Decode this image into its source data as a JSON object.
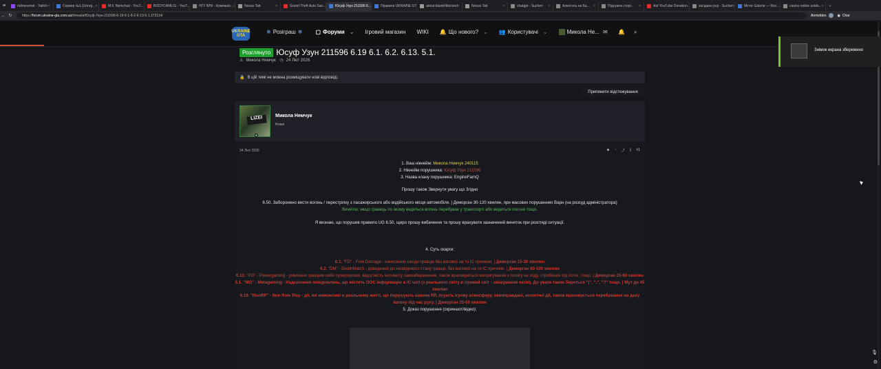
{
  "browser": {
    "menu_icon": "menu-icon",
    "tabs": [
      {
        "label": "mdmevmvk - Twitch",
        "color": "#9146ff"
      },
      {
        "label": "Сервер №1 [Unreg...",
        "color": "#3d7bd9"
      },
      {
        "label": "M.F. Nemchuk - YouT...",
        "color": "#e52d27"
      },
      {
        "label": "BODYCAMLIG - YouT...",
        "color": "#e52d27"
      },
      {
        "label": "НГУ ВЛК - Компаніо...",
        "color": "#888"
      },
      {
        "label": "Nexus Tab",
        "color": "#999"
      },
      {
        "label": "Grand Theft Auto San...",
        "color": "#e52d27"
      },
      {
        "label": "Юсуф Узун 211596 6...",
        "color": "#3d7bd9"
      },
      {
        "label": "Правила UKRAINE GT...",
        "color": "#3d7bd9"
      },
      {
        "label": "about:blank#blocked",
        "color": "#999"
      },
      {
        "label": "Nexus Tab",
        "color": "#999"
      },
      {
        "label": "chatgpt - Suchen",
        "color": "#888"
      },
      {
        "label": "Алкоголь на Ба...",
        "color": "#888"
      },
      {
        "label": "Підсумок сторі...",
        "color": "#888"
      },
      {
        "label": "Auf YouTube Donation...",
        "color": "#e52d27"
      },
      {
        "label": "засіданн рєр - Suchen",
        "color": "#888"
      },
      {
        "label": "Mirror Galerie — Rec...",
        "color": "#3d7bd9"
      },
      {
        "label": "casino online soldo...",
        "color": "#888"
      }
    ],
    "new_tab": "+",
    "url_prefix": "https://",
    "url_host": "forum.ukraine-gta.com.ua",
    "url_path": "/threads/Юсуф-Узун-211596-6-19-6-1-6-2-6-13-5-1.373114/",
    "profile_name": "Anmelden",
    "chat": "Chat"
  },
  "site": {
    "logo": "UKRAINE GTA",
    "nav": [
      {
        "label": "Розіграш",
        "icon": "snowflake-icon"
      },
      {
        "label": "Форуми",
        "icon": "chat-icon"
      },
      {
        "label": "Ігровий магазин"
      },
      {
        "label": "WIKI"
      },
      {
        "label": "Що нового?",
        "icon": "alert-icon"
      },
      {
        "label": "Користувачі",
        "icon": "users-icon"
      },
      {
        "label": "Микола Не...",
        "icon": "avatar-icon"
      }
    ],
    "status": "Розглянуто",
    "title": "Юсуф Узун 211596 6.19 6.1. 6.2. 6.13. 5.1.",
    "meta_author": "Микола Немчук",
    "meta_date": "24 Лют 2026",
    "notice": "В цій темі не можна розміщувати нові відповіді.",
    "follow": "Припинити відстежування"
  },
  "post": {
    "author": "Микола Немчук",
    "role": "Козак",
    "avatar_text": "LIZEI",
    "date": "24 Лют 2026",
    "number": "#1",
    "line1_prefix": "1. Ваш нікнейм:",
    "line1_value": "Микола Немчук 240115",
    "line2_prefix": "2. Нікнейм порушника:",
    "line2_value": "Юсуф Узун 211596",
    "line3": "3. Назва клану порушника: EngineFamQ",
    "line4": "Прошу також Звернути увагу що Згідно",
    "rule650": "6.50. Заборонено вести вогонь / перестрілку з пасажирського або водійського місця автомобіля. | Деморган 30-120 хвилин, при масових порушеннях Варн (на розсуд адміністратора)",
    "exception": "Виняток: якщо гравець по якому ведеться вогонь перебуває у транспорті або ведеться погоня тощо.",
    "admission": "Я визнаю, що порушив правило UG 6.50, щиро прошу вибачення та прошу врахувати зазначений виняток при розгляді ситуації.",
    "section4": "4. Суть скарги:",
    "violations": [
      {
        "code": "6.1.",
        "text": "\"FD\" - Free Damage - нанесення шкоди гравцю без вагомої на то IC причини. |",
        "punishment": "Деморган 15-30 хвилин"
      },
      {
        "code": "6.2.",
        "text": "\"DM\" - DeathMatch - доведення до несвідомого стану гравця, без вагомої на то IC причини. |",
        "punishment": "Деморган 60-100 хвилин"
      },
      {
        "code": "6.13.",
        "text": "\"PG\" - Powergaming - уявлення гравцем себе супергероєм, відсутність інстинкту самозбереження, також враховуються випригування з потягу на ходу, стрибання під потяг, тощо. |",
        "punishment": "Деморган 15-60 хвилин"
      },
      {
        "code": "5.1.",
        "text": "\"MG\" - Metagaming - Надсилання повідомлень, що містять OOC інформацію в IC чаті (з реального світу в ігровий світ - змішування чатів). До уваги також береться \")\", \":\", \"?\" тощо. |",
        "punishment": "Мут до 45 хвилин"
      },
      {
        "code": "6.19.",
        "text": "\"NonRP\" - Non Role Play - дії, які неможливі в реальному житті, що порушують канони RP, псують ігрову атмосферу, невиправдані, нелогічні дії, також враховується перебування на даху вагону під час руху. |",
        "punishment": "Деморган 15-60 хвилин"
      }
    ],
    "section5": "5. Доказ порушення (скриншот/відео):"
  },
  "toast": {
    "text": "Знімок екрана збережено"
  },
  "colors": {
    "status_green": "#1f9f2d",
    "accent_red": "#c53b31",
    "notice_bg": "#24252c"
  }
}
